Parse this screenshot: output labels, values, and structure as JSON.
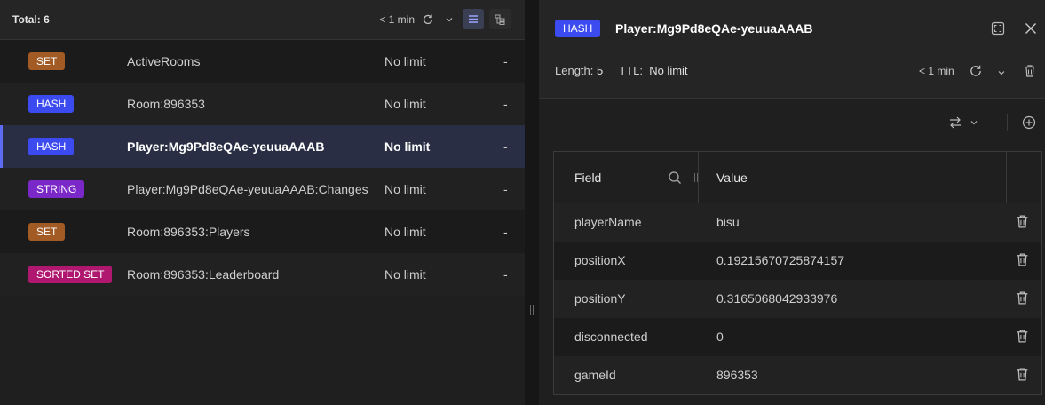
{
  "colors": {
    "set": "#a35b26",
    "hash": "#3b4bf0",
    "string": "#7b28c9",
    "sorted_set": "#b01870",
    "selected_row": "#2a2e44",
    "accent": "#5c6bf2"
  },
  "list": {
    "total": "Total: 6",
    "refresh_label": "< 1 min",
    "rows": [
      {
        "type": "SET",
        "type_color": "#a35b26",
        "key": "ActiveRooms",
        "ttl": "No limit",
        "size": "-"
      },
      {
        "type": "HASH",
        "type_color": "#3b4bf0",
        "key": "Room:896353",
        "ttl": "No limit",
        "size": "-"
      },
      {
        "type": "HASH",
        "type_color": "#3b4bf0",
        "key": "Player:Mg9Pd8eQAe-yeuuaAAAB",
        "ttl": "No limit",
        "size": "-"
      },
      {
        "type": "STRING",
        "type_color": "#7b28c9",
        "key": "Player:Mg9Pd8eQAe-yeuuaAAAB:Changes",
        "ttl": "No limit",
        "size": "-"
      },
      {
        "type": "SET",
        "type_color": "#a35b26",
        "key": "Room:896353:Players",
        "ttl": "No limit",
        "size": "-"
      },
      {
        "type": "SORTED SET",
        "type_color": "#b01870",
        "key": "Room:896353:Leaderboard",
        "ttl": "No limit",
        "size": "-"
      }
    ]
  },
  "detail": {
    "type": "HASH",
    "key": "Player:Mg9Pd8eQAe-yeuuaAAAB",
    "length_label": "Length:",
    "length_value": "5",
    "ttl_label": "TTL:",
    "ttl_value": "No limit",
    "refresh_label": "< 1 min",
    "table": {
      "field_header": "Field",
      "value_header": "Value",
      "rows": [
        {
          "field": "playerName",
          "value": "bisu"
        },
        {
          "field": "positionX",
          "value": "0.19215670725874157"
        },
        {
          "field": "positionY",
          "value": "0.3165068042933976"
        },
        {
          "field": "disconnected",
          "value": "0"
        },
        {
          "field": "gameId",
          "value": "896353"
        }
      ]
    }
  },
  "icons": [
    "refresh-icon",
    "chevron-down-icon",
    "list-view-icon",
    "tree-view-icon",
    "fullscreen-icon",
    "close-icon",
    "delete-icon",
    "swap-icon",
    "add-icon",
    "search-icon"
  ]
}
